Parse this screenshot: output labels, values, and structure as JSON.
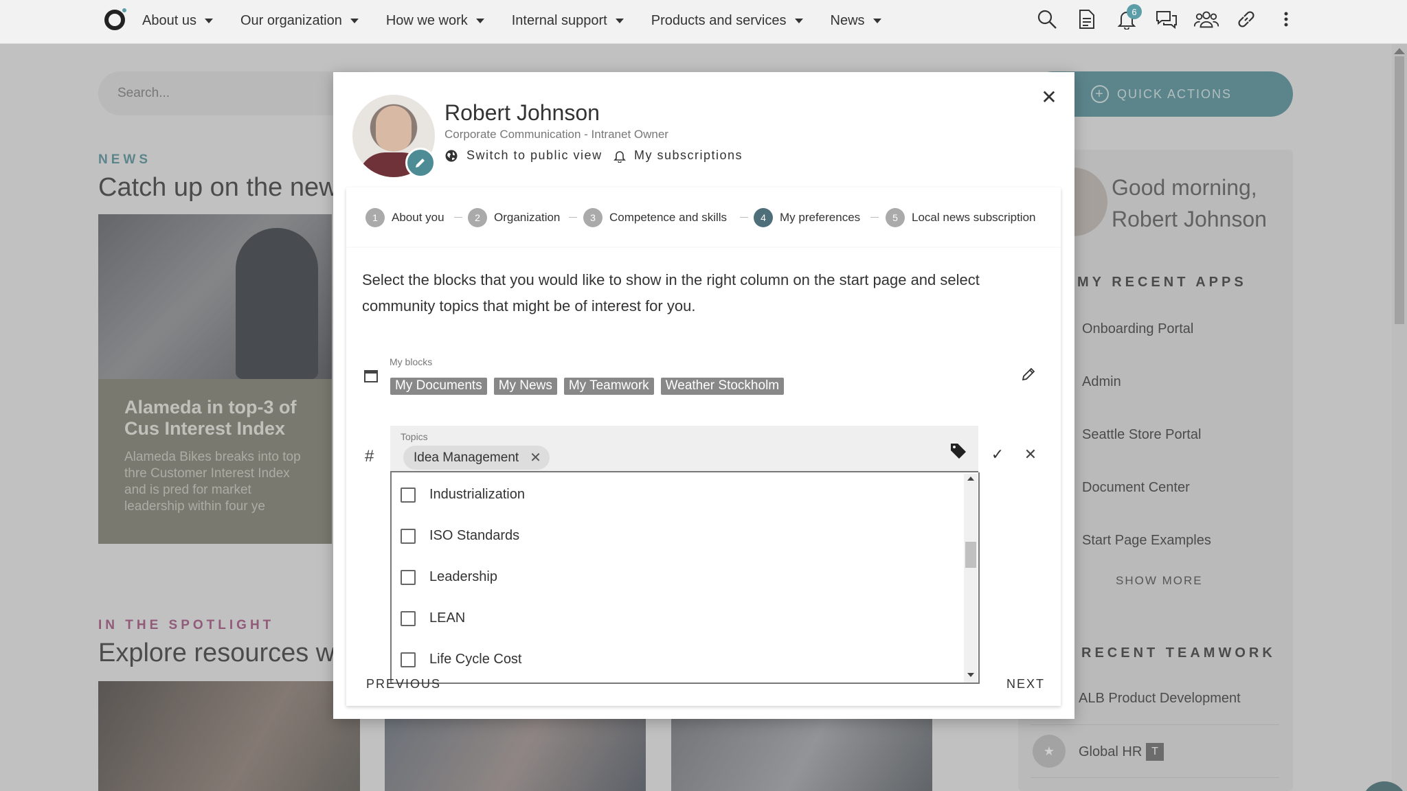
{
  "nav": {
    "items": [
      {
        "label": "About us"
      },
      {
        "label": "Our organization"
      },
      {
        "label": "How we work"
      },
      {
        "label": "Internal support"
      },
      {
        "label": "Products and services"
      },
      {
        "label": "News"
      }
    ],
    "icons": [
      "search-icon",
      "document-icon",
      "bell-icon",
      "chat-icon",
      "people-icon",
      "link-icon",
      "more-vertical-icon"
    ],
    "notification_count": "6"
  },
  "page": {
    "search_placeholder": "Search...",
    "quick_actions": "QUICK ACTIONS",
    "news": {
      "label": "NEWS",
      "title": "Catch up on the new",
      "card_title": "Alameda in top-3 of Cus Interest Index",
      "card_desc": "Alameda Bikes breaks into top thre Customer Interest Index and is pred for market leadership within four ye"
    },
    "spotlight": {
      "label": "IN THE SPOTLIGHT",
      "title": "Explore resources wi"
    },
    "right": {
      "greeting_line1": "Good morning,",
      "greeting_line2": "Robert Johnson",
      "recent_apps_label": "MY RECENT APPS",
      "apps": [
        "Onboarding Portal",
        "Admin",
        "Seattle Store Portal",
        "Document Center",
        "Start Page Examples"
      ],
      "show_more": "SHOW MORE",
      "teamwork_label": "RECENT TEAMWORK",
      "teamwork": [
        "ALB Product Development",
        "Global HR"
      ]
    }
  },
  "modal": {
    "name": "Robert Johnson",
    "role": "Corporate Communication - Intranet Owner",
    "public_view": "Switch to public view",
    "subscriptions": "My subscriptions",
    "steps": [
      {
        "num": "1",
        "label": "About you"
      },
      {
        "num": "2",
        "label": "Organization"
      },
      {
        "num": "3",
        "label": "Competence and skills"
      },
      {
        "num": "4",
        "label": "My preferences"
      },
      {
        "num": "5",
        "label": "Local news subscription"
      }
    ],
    "active_step": 4,
    "intro": "Select the blocks that you would like to show in the right column on the start page and select community topics that might be of interest for you.",
    "blocks_label": "My blocks",
    "blocks": [
      "My Documents",
      "My News",
      "My Teamwork",
      "Weather Stockholm"
    ],
    "topics_label": "Topics",
    "selected_topic": "Idea Management",
    "topic_options": [
      "Industrialization",
      "ISO Standards",
      "Leadership",
      "LEAN",
      "Life Cycle Cost"
    ],
    "previous": "PREVIOUS",
    "next": "NEXT"
  },
  "colors": {
    "accent": "#4e8c95",
    "news_label": "#4e8c95",
    "spotlight_label": "#a04a7a"
  }
}
